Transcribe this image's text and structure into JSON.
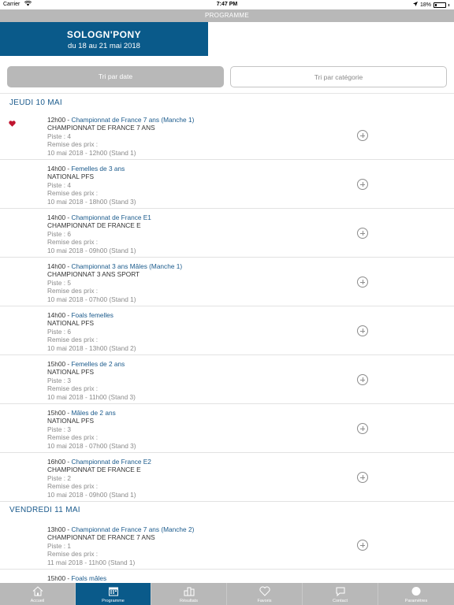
{
  "status_bar": {
    "carrier": "Carrier",
    "time": "7:47 PM",
    "battery": "18%"
  },
  "nav": {
    "title": "PROGRAMME"
  },
  "banner": {
    "name": "SOLOGN'PONY",
    "dates": "du 18 au 21 mai 2018"
  },
  "tabs": {
    "by_date": "Tri par date",
    "by_category": "Tri par catégorie",
    "selected": "by_date"
  },
  "days": [
    {
      "label": "JEUDI 10 MAI",
      "events": [
        {
          "time": "12h00",
          "name": "Championnat de France 7 ans (Manche 1)",
          "category": "CHAMPIONNAT DE FRANCE 7 ANS",
          "piste": "Piste : 4",
          "remise_label": "Remise des prix :",
          "remise": "10 mai 2018 - 12h00 (Stand 1)",
          "favorite": true
        },
        {
          "time": "14h00",
          "name": "Femelles de 3 ans",
          "category": "NATIONAL PFS",
          "piste": "Piste : 4",
          "remise_label": "Remise des prix :",
          "remise": "10 mai 2018 - 18h00 (Stand 3)",
          "favorite": false
        },
        {
          "time": "14h00",
          "name": "Championnat de France E1",
          "category": "CHAMPIONNAT DE FRANCE E",
          "piste": "Piste : 6",
          "remise_label": "Remise des prix :",
          "remise": "10 mai 2018 - 09h00 (Stand 1)",
          "favorite": false
        },
        {
          "time": "14h00",
          "name": "Championnat 3 ans Mâles (Manche 1)",
          "category": "CHAMPIONNAT 3 ANS SPORT",
          "piste": "Piste : 5",
          "remise_label": "Remise des prix :",
          "remise": "10 mai 2018 - 07h00 (Stand 1)",
          "favorite": false
        },
        {
          "time": "14h00",
          "name": "Foals femelles",
          "category": "NATIONAL PFS",
          "piste": "Piste : 6",
          "remise_label": "Remise des prix :",
          "remise": "10 mai 2018 - 13h00 (Stand 2)",
          "favorite": false
        },
        {
          "time": "15h00",
          "name": "Femelles de 2 ans",
          "category": "NATIONAL PFS",
          "piste": "Piste : 3",
          "remise_label": "Remise des prix :",
          "remise": "10 mai 2018 - 11h00 (Stand 3)",
          "favorite": false
        },
        {
          "time": "15h00",
          "name": "Mâles de 2 ans",
          "category": "NATIONAL PFS",
          "piste": "Piste : 3",
          "remise_label": "Remise des prix :",
          "remise": "10 mai 2018 - 07h00 (Stand 3)",
          "favorite": false
        },
        {
          "time": "16h00",
          "name": "Championnat de France E2",
          "category": "CHAMPIONNAT DE FRANCE E",
          "piste": "Piste : 2",
          "remise_label": "Remise des prix :",
          "remise": "10 mai 2018 - 09h00 (Stand 1)",
          "favorite": false
        }
      ]
    },
    {
      "label": "VENDREDI 11 MAI",
      "events": [
        {
          "time": "13h00",
          "name": "Championnat de France 7 ans (Manche 2)",
          "category": "CHAMPIONNAT DE FRANCE 7 ANS",
          "piste": "Piste : 1",
          "remise_label": "Remise des prix :",
          "remise": "11 mai 2018 - 11h00 (Stand 1)",
          "favorite": false
        },
        {
          "time": "15h00",
          "name": "Foals mâles",
          "category": "",
          "piste": "",
          "remise_label": "",
          "remise": "",
          "favorite": false
        }
      ]
    }
  ],
  "tab_bar": [
    {
      "label": "Accueil",
      "icon": "home-icon",
      "active": false
    },
    {
      "label": "Programme",
      "icon": "calendar-icon",
      "active": true
    },
    {
      "label": "Résultats",
      "icon": "podium-icon",
      "active": false
    },
    {
      "label": "Favoris",
      "icon": "heart-icon",
      "active": false
    },
    {
      "label": "Contact",
      "icon": "chat-icon",
      "active": false
    },
    {
      "label": "Paramètres",
      "icon": "settings-icon",
      "active": false
    }
  ],
  "colors": {
    "brand_blue": "#0a5a8a",
    "link_blue": "#1a5a8c",
    "bar_grey": "#b8b8b8",
    "favorite_red": "#c0152f"
  }
}
